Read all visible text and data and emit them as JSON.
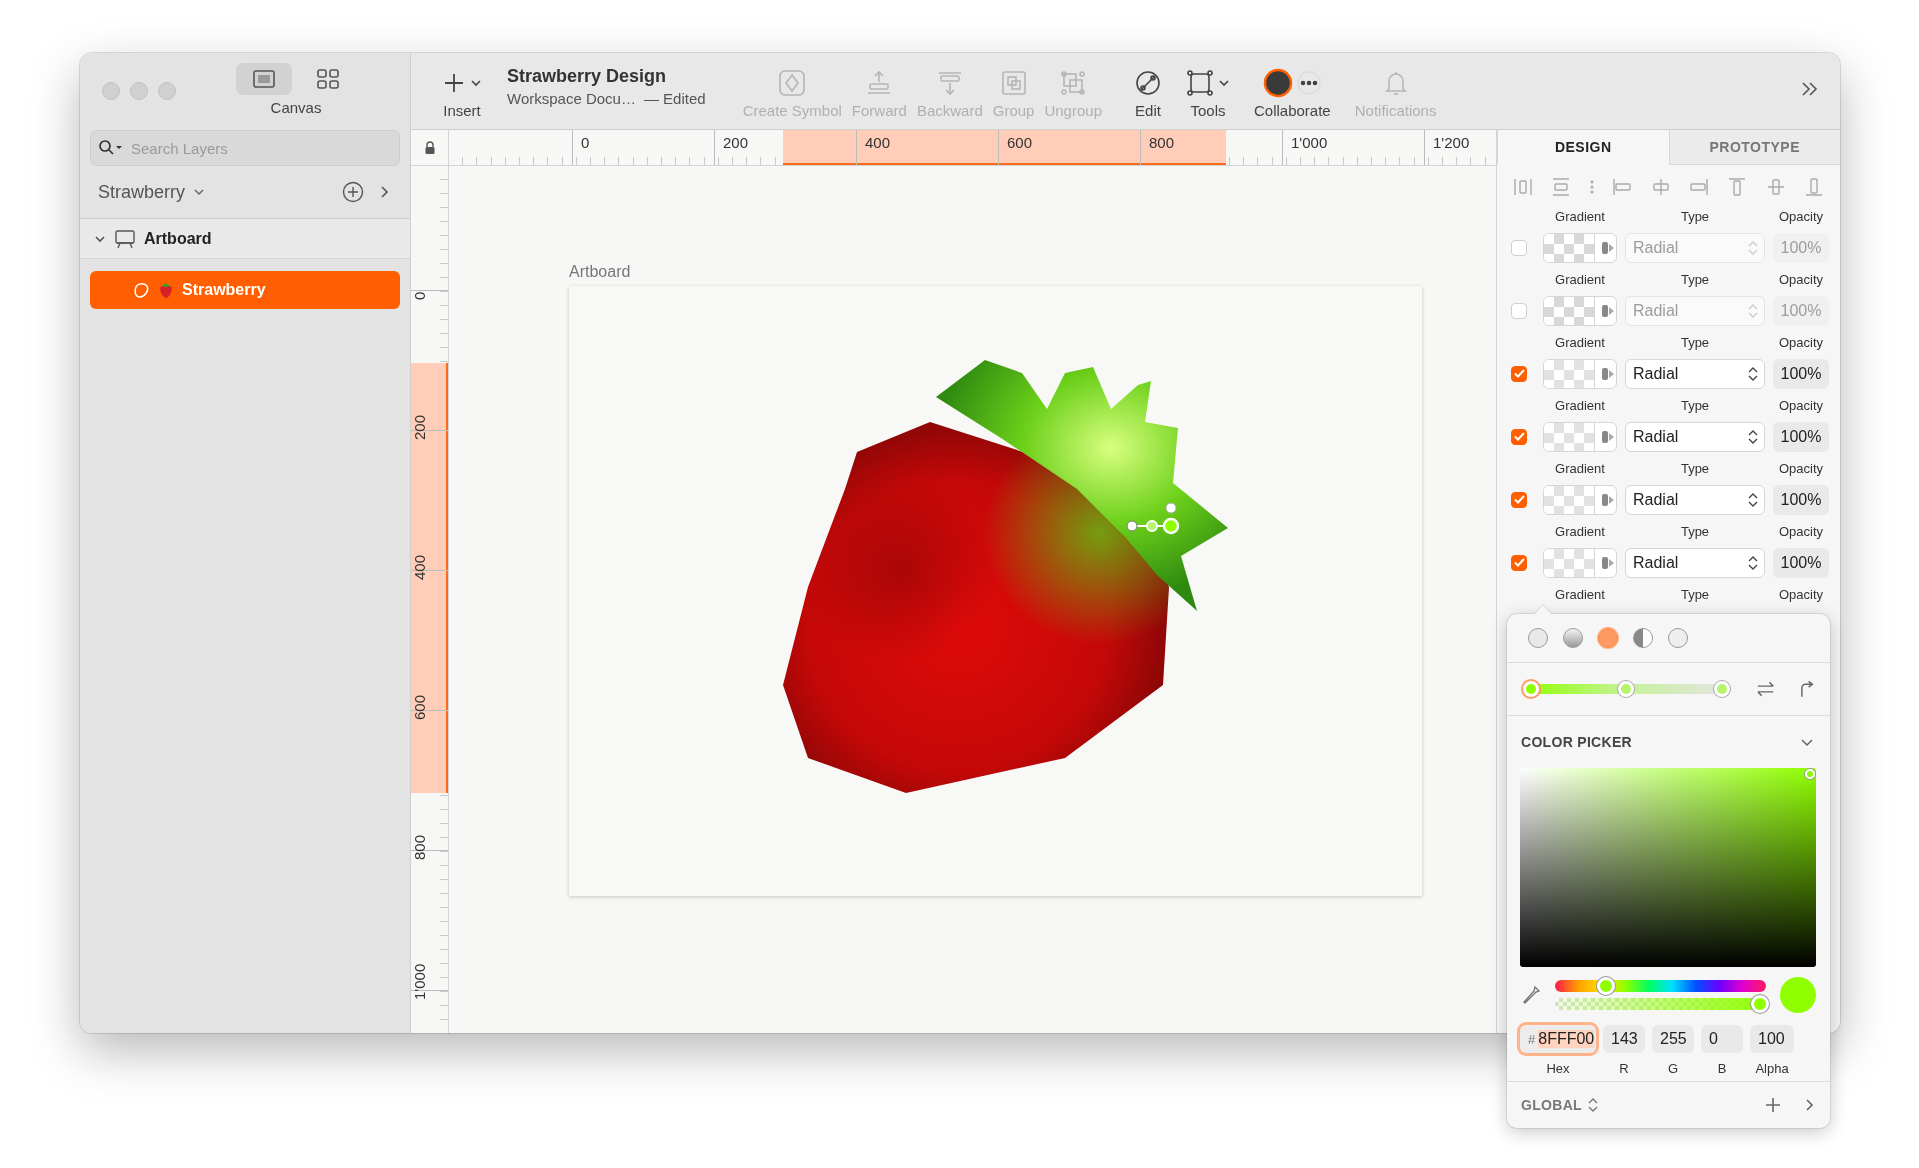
{
  "sidebar": {
    "view_modes": [
      {
        "selected": true
      },
      {
        "selected": false
      }
    ],
    "view_label": "Canvas",
    "search": {
      "placeholder": "Search Layers"
    },
    "page": {
      "name": "Strawberry"
    },
    "layers": [
      {
        "name": "Artboard",
        "kind": "artboard",
        "expanded": true,
        "selected": false,
        "children": [
          {
            "name": "Strawberry",
            "kind": "shape",
            "selected": true
          }
        ]
      }
    ]
  },
  "toolbar": {
    "insert": {
      "label": "Insert"
    },
    "document": {
      "title": "Strawberry Design",
      "subtitle": "Workspace Docu…",
      "status": "— Edited"
    },
    "tools": [
      {
        "kind": "symbol",
        "label": "Create Symbol",
        "disabled": true
      },
      {
        "kind": "forward",
        "label": "Forward",
        "disabled": true
      },
      {
        "kind": "backward",
        "label": "Backward",
        "disabled": true
      },
      {
        "kind": "group",
        "label": "Group",
        "disabled": true
      },
      {
        "kind": "ungroup",
        "label": "Ungroup",
        "disabled": true
      },
      {
        "kind": "edit",
        "label": "Edit",
        "disabled": false
      },
      {
        "kind": "tools",
        "label": "Tools",
        "disabled": false
      },
      {
        "kind": "collaborate",
        "label": "Collaborate",
        "disabled": false
      },
      {
        "kind": "notifications",
        "label": "Notifications",
        "disabled": true
      }
    ]
  },
  "rulers": {
    "horizontal": [
      "0",
      "200",
      "400",
      "600",
      "800",
      "1'000",
      "1'200"
    ],
    "vertical": [
      "0",
      "200",
      "400",
      "600",
      "800",
      "1'000"
    ]
  },
  "artboard": {
    "label": "Artboard"
  },
  "inspector": {
    "tabs": [
      {
        "label": "DESIGN",
        "selected": true
      },
      {
        "label": "PROTOTYPE",
        "selected": false
      }
    ],
    "fills": [
      {
        "labels": [
          "Gradient",
          "Type",
          "Opacity"
        ],
        "enabled": false,
        "type": "Radial",
        "opacity": "100%"
      },
      {
        "labels": [
          "Gradient",
          "Type",
          "Opacity"
        ],
        "enabled": false,
        "type": "Radial",
        "opacity": "100%"
      },
      {
        "labels": [
          "Gradient",
          "Type",
          "Opacity"
        ],
        "enabled": true,
        "type": "Radial",
        "opacity": "100%"
      },
      {
        "labels": [
          "Gradient",
          "Type",
          "Opacity"
        ],
        "enabled": true,
        "type": "Radial",
        "opacity": "100%"
      },
      {
        "labels": [
          "Gradient",
          "Type",
          "Opacity"
        ],
        "enabled": true,
        "type": "Radial",
        "opacity": "100%"
      },
      {
        "labels": [
          "Gradient",
          "Type",
          "Opacity"
        ],
        "enabled": true,
        "type": "Radial",
        "opacity": "100%"
      }
    ],
    "trailing_labels": [
      "Gradient",
      "Type",
      "Opacity"
    ]
  },
  "gradient_popover": {
    "fill_types": [
      {
        "kind": "solid",
        "selected": false
      },
      {
        "kind": "linear",
        "selected": false
      },
      {
        "kind": "radial",
        "selected": true
      },
      {
        "kind": "angular",
        "selected": false
      },
      {
        "kind": "image",
        "selected": false
      }
    ],
    "stops": [
      {
        "selected": true
      },
      {
        "selected": false
      },
      {
        "selected": false
      }
    ],
    "color_picker": {
      "title": "COLOR PICKER",
      "expanded": true,
      "hue": {
        "level": 0.24
      },
      "alpha": {
        "level": 1
      }
    },
    "fields": [
      {
        "kind": "hex",
        "prefix": "#",
        "value": "8FFF00",
        "label": "Hex",
        "focused": true
      },
      {
        "kind": "number",
        "value": "143",
        "label": "R",
        "focused": false
      },
      {
        "kind": "number",
        "value": "255",
        "label": "G",
        "focused": false
      },
      {
        "kind": "number",
        "value": "0",
        "label": "B",
        "focused": false
      },
      {
        "kind": "number",
        "value": "100",
        "label": "Alpha",
        "focused": false
      }
    ],
    "footer": {
      "label": "GLOBAL"
    }
  }
}
